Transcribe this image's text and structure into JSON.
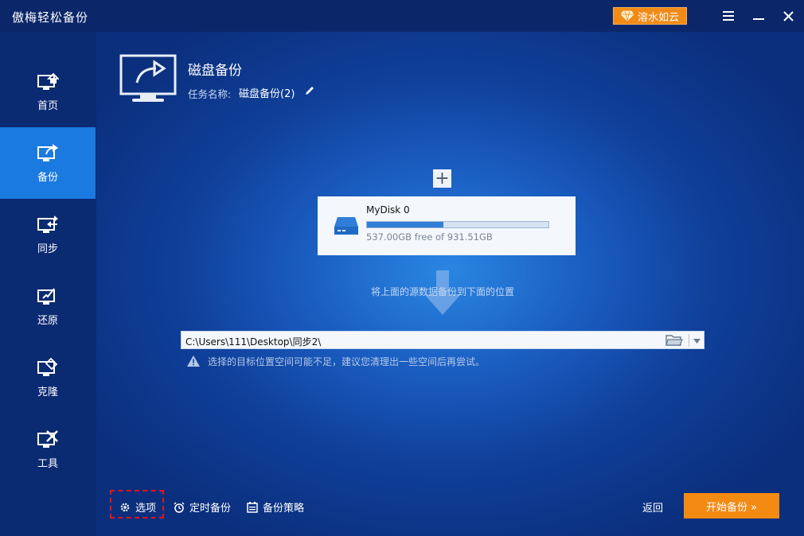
{
  "app": {
    "title": "傲梅轻松备份"
  },
  "titlebar": {
    "upgrade_label": "溶水如云"
  },
  "sidebar": {
    "items": [
      {
        "label": "首页",
        "icon": "home-monitor-icon",
        "active": false
      },
      {
        "label": "备份",
        "icon": "backup-monitor-icon",
        "active": true
      },
      {
        "label": "同步",
        "icon": "sync-monitor-icon",
        "active": false
      },
      {
        "label": "还原",
        "icon": "restore-monitor-icon",
        "active": false
      },
      {
        "label": "克隆",
        "icon": "clone-monitor-icon",
        "active": false
      },
      {
        "label": "工具",
        "icon": "tools-monitor-icon",
        "active": false
      }
    ]
  },
  "header": {
    "title": "磁盘备份",
    "task_label": "任务名称:",
    "task_name": "磁盘备份(2)"
  },
  "source": {
    "add_label": "+",
    "disk": {
      "name": "MyDisk 0",
      "usage_fraction": 0.42,
      "free_text": "537.00GB free of 931.51GB"
    }
  },
  "hint": "将上面的源数据备份到下面的位置",
  "destination": {
    "path": "C:\\Users\\111\\Desktop\\同步2\\",
    "warning": "选择的目标位置空间可能不足，建议您清理出一些空间后再尝试。"
  },
  "footer": {
    "options_label": "选项",
    "schedule_label": "定时备份",
    "scheme_label": "备份策略",
    "back_label": "返回",
    "start_label": "开始备份 »"
  },
  "colors": {
    "accent": "#1a7ae0",
    "start_button": "#f38a12",
    "highlight_box": "#e0141c"
  }
}
